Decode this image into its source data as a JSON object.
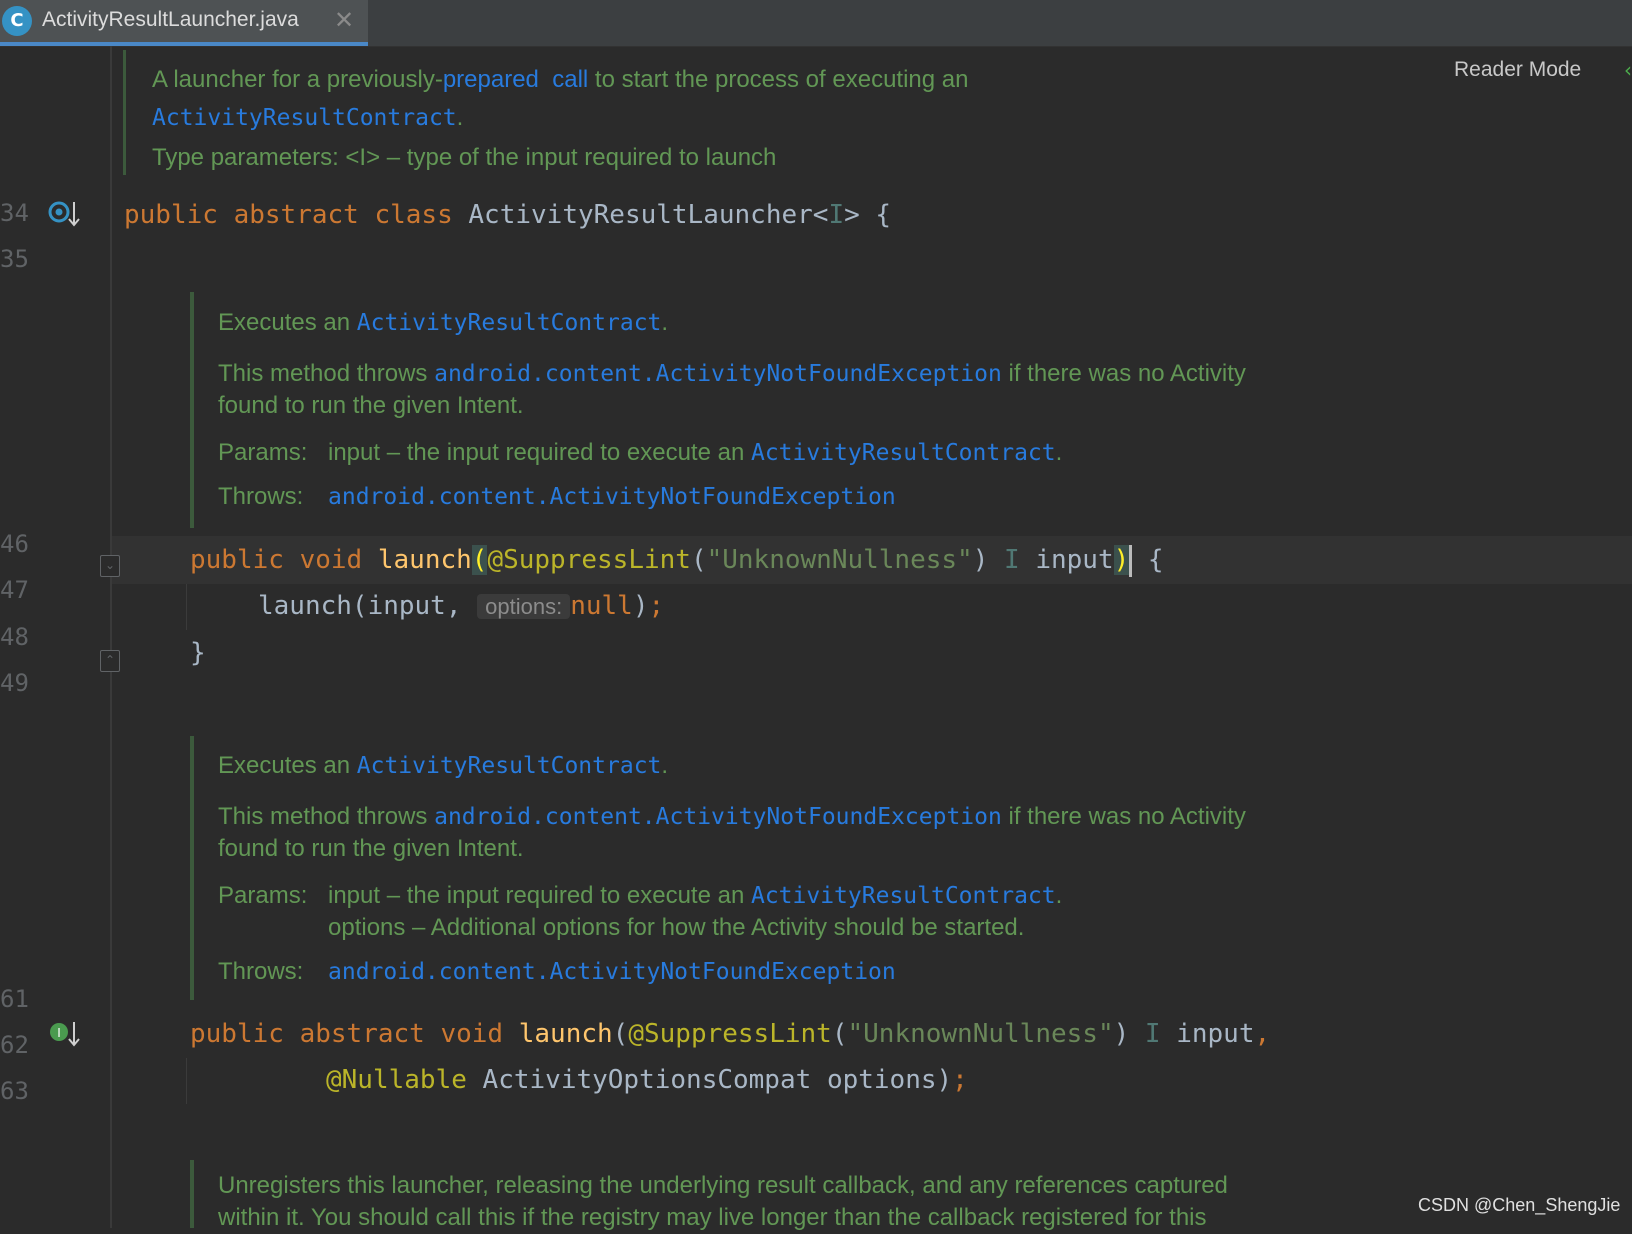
{
  "tab": {
    "filename": "ActivityResultLauncher.java",
    "icon_letter": "C"
  },
  "reader_mode": "Reader Mode",
  "line_numbers": {
    "l34": "34",
    "l35": "35",
    "l46": "46",
    "l47": "47",
    "l48": "48",
    "l49": "49",
    "l61": "61",
    "l62": "62",
    "l63": "63"
  },
  "class_doc": {
    "t1": "A launcher for a previously-",
    "t2": "prepared",
    "t3": "call",
    "t4": "to start the process of executing an",
    "ref": "ActivityResultContract",
    "dot": ".",
    "type_params": "Type parameters: <I> – type of the input required to launch"
  },
  "code": {
    "kw_public": "public",
    "kw_abstract": "abstract",
    "kw_class": "class",
    "kw_void": "void",
    "kw_null": "null",
    "class_name": "ActivityResultLauncher<",
    "type_param": "I",
    "class_end": "> {",
    "launch": "launch",
    "annotation": "@SuppressLint",
    "str_unknown": "\"UnknownNullness\"",
    "paren_open": "(",
    "paren_close": ")",
    "input": "input",
    "brace_open": "{",
    "call_start": "launch(input, ",
    "hint_options": "options:",
    "call_end": ");",
    "semicolon": ";",
    "close_brace": "}",
    "comma": ",",
    "nullable": "@Nullable",
    "options_type": "ActivityOptionsCompat",
    "options_param": "options)"
  },
  "doc1": {
    "exec_prefix": "Executes an ",
    "exec_ref": "ActivityResultContract",
    "dot": ".",
    "throws_prefix": "This method throws ",
    "throws_ref": "android.content.ActivityNotFoundException",
    "throws_suffix": " if there was no Activity",
    "throws_line2": "found to run the given Intent.",
    "params_label": "Params:",
    "params_text": "input – the input required to execute an ",
    "params_ref": "ActivityResultContract",
    "throws_label": "Throws:",
    "throws_val": "android.content.ActivityNotFoundException"
  },
  "doc2": {
    "options_text": "options – Additional options for how the Activity should be started."
  },
  "doc3": {
    "line1": "Unregisters this launcher, releasing the underlying result callback, and any references captured",
    "line2": "within it. You should call this if the registry may live longer than the callback registered for this"
  },
  "watermark": "CSDN @Chen_ShengJie",
  "colors": {
    "background": "#2b2b2b",
    "keyword": "#cc7832",
    "function": "#ffc66d",
    "annotation": "#bbb529",
    "string": "#6a8759",
    "doc": "#629755",
    "doc_link": "#287bde"
  }
}
